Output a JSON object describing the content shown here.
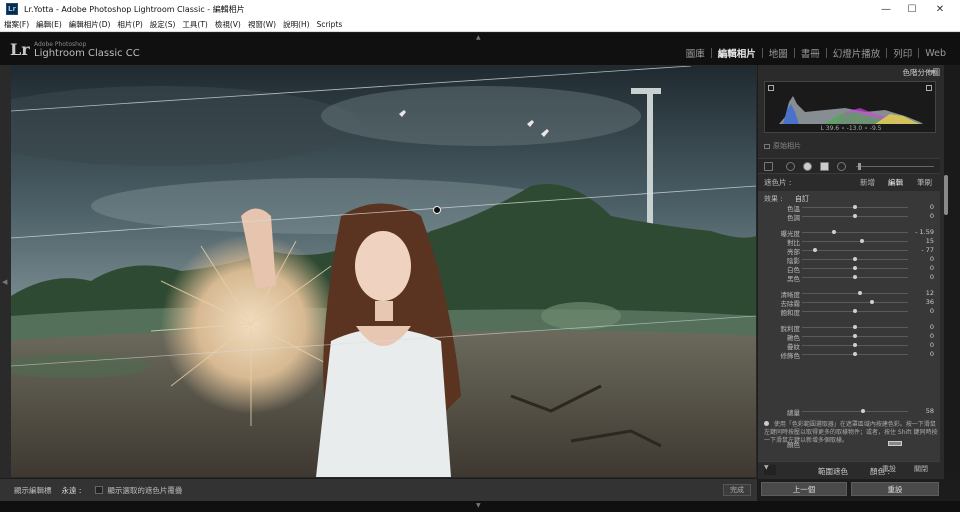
{
  "window": {
    "title": "Lr.Yotta - Adobe Photoshop Lightroom Classic - 編輯相片",
    "minimize": "—",
    "maximize": "☐",
    "close": "✕"
  },
  "menu": [
    "檔案(F)",
    "編輯(E)",
    "編輯相片(D)",
    "相片(P)",
    "設定(S)",
    "工具(T)",
    "檢視(V)",
    "視窗(W)",
    "說明(H)",
    "Scripts"
  ],
  "brand": {
    "logo": "Lr",
    "line1": "Adobe Photoshop",
    "line2": "Lightroom Classic CC"
  },
  "modules": [
    "圖庫",
    "編輯相片",
    "地圖",
    "書冊",
    "幻燈片播放",
    "列印",
    "Web"
  ],
  "active_module": "編輯相片",
  "histogram": {
    "title": "色階分佈圖",
    "readout": "L  39.6  ∘  -13.0  ∘  -9.5"
  },
  "original_photo": "原始相片",
  "mask": {
    "label": "遮色片 :",
    "new": "新增",
    "edit": "編輯",
    "brush": "筆刷"
  },
  "effect": {
    "label": "效果 :",
    "selected": "自訂"
  },
  "sliders": [
    {
      "label": "色溫",
      "value": "0",
      "pos": 0.5
    },
    {
      "label": "色調",
      "value": "0",
      "pos": 0.5
    },
    {
      "label": "曝光度",
      "value": "- 1.59",
      "pos": 0.3
    },
    {
      "label": "對比",
      "value": "15",
      "pos": 0.57
    },
    {
      "label": "亮部",
      "value": "- 77",
      "pos": 0.12
    },
    {
      "label": "陰影",
      "value": "0",
      "pos": 0.5
    },
    {
      "label": "白色",
      "value": "0",
      "pos": 0.5
    },
    {
      "label": "黑色",
      "value": "0",
      "pos": 0.5
    },
    {
      "label": "清晰度",
      "value": "12",
      "pos": 0.55
    },
    {
      "label": "去除霧",
      "value": "36",
      "pos": 0.66
    },
    {
      "label": "飽和度",
      "value": "0",
      "pos": 0.5
    },
    {
      "label": "銳利度",
      "value": "0",
      "pos": 0.5
    },
    {
      "label": "雜色",
      "value": "0",
      "pos": 0.5
    },
    {
      "label": "疊紋",
      "value": "0",
      "pos": 0.5
    },
    {
      "label": "修飾色",
      "value": "0",
      "pos": 0.5
    }
  ],
  "color_label": "顏色",
  "range_mask": {
    "label": "範圍遮色",
    "value": "顏色 :"
  },
  "amount": {
    "label": "總量",
    "value": "58",
    "pos": 0.58
  },
  "hint": "使用「色彩範圍選取器」在遮罩區域內按建色彩。按一下滑鼠左鍵同時按壓以取得更多的取樣物件；或者，按住 Shift 鍵同時按一下滑鼠左鍵以新增多個取樣。",
  "panel_footer": {
    "reset": "重設",
    "close": "關閉"
  },
  "toolbar": {
    "show_tool": "顯示編輯標",
    "always": "永遠 :",
    "overlay": "顯示選取的遮色片覆疊",
    "done": "完成"
  },
  "buttons": {
    "previous": "上一個",
    "reset": "重設"
  }
}
